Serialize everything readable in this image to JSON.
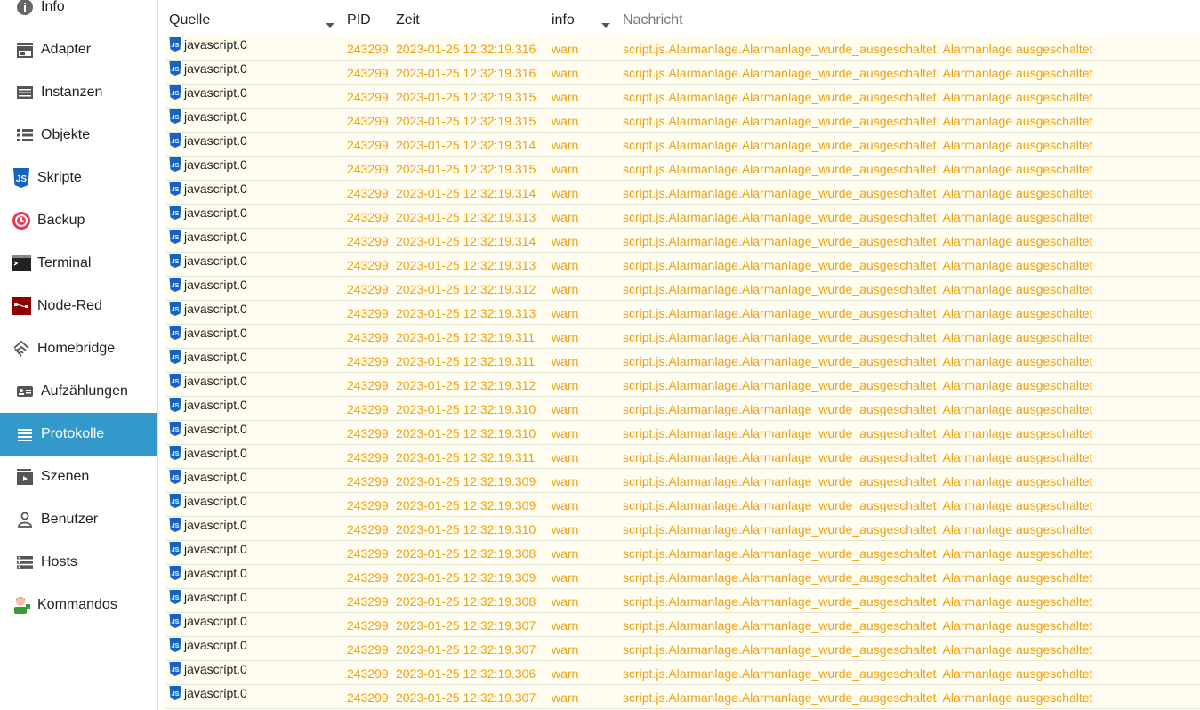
{
  "sidebar": {
    "items": [
      {
        "label": "Info",
        "icon": "info-icon"
      },
      {
        "label": "Adapter",
        "icon": "store-icon"
      },
      {
        "label": "Instanzen",
        "icon": "instances-icon"
      },
      {
        "label": "Objekte",
        "icon": "list-icon"
      },
      {
        "label": "Skripte",
        "icon": "javascript-icon"
      },
      {
        "label": "Backup",
        "icon": "backup-icon"
      },
      {
        "label": "Terminal",
        "icon": "terminal-icon"
      },
      {
        "label": "Node-Red",
        "icon": "node-red-icon"
      },
      {
        "label": "Homebridge",
        "icon": "homebridge-icon"
      },
      {
        "label": "Aufzählungen",
        "icon": "enum-icon"
      },
      {
        "label": "Protokolle",
        "icon": "log-icon",
        "active": true
      },
      {
        "label": "Szenen",
        "icon": "scenes-icon"
      },
      {
        "label": "Benutzer",
        "icon": "user-icon"
      },
      {
        "label": "Hosts",
        "icon": "hosts-icon"
      },
      {
        "label": "Kommandos",
        "icon": "commands-icon"
      }
    ]
  },
  "header": {
    "source_label": "Quelle",
    "pid_label": "PID",
    "time_label": "Zeit",
    "severity_value": "info",
    "message_placeholder": "Nachricht"
  },
  "colors": {
    "accent": "#3399cc",
    "warn": "#f0a010",
    "row_bg": "#fffdf0"
  },
  "log": {
    "rows": [
      {
        "source": "javascript.0",
        "pid": "243299",
        "time": "2023-01-25 12:32:19.316",
        "severity": "warn",
        "message": "script.js.Alarmanlage.Alarmanlage_wurde_ausgeschaltet: Alarmanlage ausgeschaltet"
      },
      {
        "source": "javascript.0",
        "pid": "243299",
        "time": "2023-01-25 12:32:19.316",
        "severity": "warn",
        "message": "script.js.Alarmanlage.Alarmanlage_wurde_ausgeschaltet: Alarmanlage ausgeschaltet"
      },
      {
        "source": "javascript.0",
        "pid": "243299",
        "time": "2023-01-25 12:32:19.315",
        "severity": "warn",
        "message": "script.js.Alarmanlage.Alarmanlage_wurde_ausgeschaltet: Alarmanlage ausgeschaltet"
      },
      {
        "source": "javascript.0",
        "pid": "243299",
        "time": "2023-01-25 12:32:19.315",
        "severity": "warn",
        "message": "script.js.Alarmanlage.Alarmanlage_wurde_ausgeschaltet: Alarmanlage ausgeschaltet"
      },
      {
        "source": "javascript.0",
        "pid": "243299",
        "time": "2023-01-25 12:32:19.314",
        "severity": "warn",
        "message": "script.js.Alarmanlage.Alarmanlage_wurde_ausgeschaltet: Alarmanlage ausgeschaltet"
      },
      {
        "source": "javascript.0",
        "pid": "243299",
        "time": "2023-01-25 12:32:19.315",
        "severity": "warn",
        "message": "script.js.Alarmanlage.Alarmanlage_wurde_ausgeschaltet: Alarmanlage ausgeschaltet"
      },
      {
        "source": "javascript.0",
        "pid": "243299",
        "time": "2023-01-25 12:32:19.314",
        "severity": "warn",
        "message": "script.js.Alarmanlage.Alarmanlage_wurde_ausgeschaltet: Alarmanlage ausgeschaltet"
      },
      {
        "source": "javascript.0",
        "pid": "243299",
        "time": "2023-01-25 12:32:19.313",
        "severity": "warn",
        "message": "script.js.Alarmanlage.Alarmanlage_wurde_ausgeschaltet: Alarmanlage ausgeschaltet"
      },
      {
        "source": "javascript.0",
        "pid": "243299",
        "time": "2023-01-25 12:32:19.314",
        "severity": "warn",
        "message": "script.js.Alarmanlage.Alarmanlage_wurde_ausgeschaltet: Alarmanlage ausgeschaltet"
      },
      {
        "source": "javascript.0",
        "pid": "243299",
        "time": "2023-01-25 12:32:19.313",
        "severity": "warn",
        "message": "script.js.Alarmanlage.Alarmanlage_wurde_ausgeschaltet: Alarmanlage ausgeschaltet"
      },
      {
        "source": "javascript.0",
        "pid": "243299",
        "time": "2023-01-25 12:32:19.312",
        "severity": "warn",
        "message": "script.js.Alarmanlage.Alarmanlage_wurde_ausgeschaltet: Alarmanlage ausgeschaltet"
      },
      {
        "source": "javascript.0",
        "pid": "243299",
        "time": "2023-01-25 12:32:19.313",
        "severity": "warn",
        "message": "script.js.Alarmanlage.Alarmanlage_wurde_ausgeschaltet: Alarmanlage ausgeschaltet"
      },
      {
        "source": "javascript.0",
        "pid": "243299",
        "time": "2023-01-25 12:32:19.311",
        "severity": "warn",
        "message": "script.js.Alarmanlage.Alarmanlage_wurde_ausgeschaltet: Alarmanlage ausgeschaltet"
      },
      {
        "source": "javascript.0",
        "pid": "243299",
        "time": "2023-01-25 12:32:19.311",
        "severity": "warn",
        "message": "script.js.Alarmanlage.Alarmanlage_wurde_ausgeschaltet: Alarmanlage ausgeschaltet"
      },
      {
        "source": "javascript.0",
        "pid": "243299",
        "time": "2023-01-25 12:32:19.312",
        "severity": "warn",
        "message": "script.js.Alarmanlage.Alarmanlage_wurde_ausgeschaltet: Alarmanlage ausgeschaltet"
      },
      {
        "source": "javascript.0",
        "pid": "243299",
        "time": "2023-01-25 12:32:19.310",
        "severity": "warn",
        "message": "script.js.Alarmanlage.Alarmanlage_wurde_ausgeschaltet: Alarmanlage ausgeschaltet"
      },
      {
        "source": "javascript.0",
        "pid": "243299",
        "time": "2023-01-25 12:32:19.310",
        "severity": "warn",
        "message": "script.js.Alarmanlage.Alarmanlage_wurde_ausgeschaltet: Alarmanlage ausgeschaltet"
      },
      {
        "source": "javascript.0",
        "pid": "243299",
        "time": "2023-01-25 12:32:19.311",
        "severity": "warn",
        "message": "script.js.Alarmanlage.Alarmanlage_wurde_ausgeschaltet: Alarmanlage ausgeschaltet"
      },
      {
        "source": "javascript.0",
        "pid": "243299",
        "time": "2023-01-25 12:32:19.309",
        "severity": "warn",
        "message": "script.js.Alarmanlage.Alarmanlage_wurde_ausgeschaltet: Alarmanlage ausgeschaltet"
      },
      {
        "source": "javascript.0",
        "pid": "243299",
        "time": "2023-01-25 12:32:19.309",
        "severity": "warn",
        "message": "script.js.Alarmanlage.Alarmanlage_wurde_ausgeschaltet: Alarmanlage ausgeschaltet"
      },
      {
        "source": "javascript.0",
        "pid": "243299",
        "time": "2023-01-25 12:32:19.310",
        "severity": "warn",
        "message": "script.js.Alarmanlage.Alarmanlage_wurde_ausgeschaltet: Alarmanlage ausgeschaltet"
      },
      {
        "source": "javascript.0",
        "pid": "243299",
        "time": "2023-01-25 12:32:19.308",
        "severity": "warn",
        "message": "script.js.Alarmanlage.Alarmanlage_wurde_ausgeschaltet: Alarmanlage ausgeschaltet"
      },
      {
        "source": "javascript.0",
        "pid": "243299",
        "time": "2023-01-25 12:32:19.309",
        "severity": "warn",
        "message": "script.js.Alarmanlage.Alarmanlage_wurde_ausgeschaltet: Alarmanlage ausgeschaltet"
      },
      {
        "source": "javascript.0",
        "pid": "243299",
        "time": "2023-01-25 12:32:19.308",
        "severity": "warn",
        "message": "script.js.Alarmanlage.Alarmanlage_wurde_ausgeschaltet: Alarmanlage ausgeschaltet"
      },
      {
        "source": "javascript.0",
        "pid": "243299",
        "time": "2023-01-25 12:32:19.307",
        "severity": "warn",
        "message": "script.js.Alarmanlage.Alarmanlage_wurde_ausgeschaltet: Alarmanlage ausgeschaltet"
      },
      {
        "source": "javascript.0",
        "pid": "243299",
        "time": "2023-01-25 12:32:19.307",
        "severity": "warn",
        "message": "script.js.Alarmanlage.Alarmanlage_wurde_ausgeschaltet: Alarmanlage ausgeschaltet"
      },
      {
        "source": "javascript.0",
        "pid": "243299",
        "time": "2023-01-25 12:32:19.306",
        "severity": "warn",
        "message": "script.js.Alarmanlage.Alarmanlage_wurde_ausgeschaltet: Alarmanlage ausgeschaltet"
      },
      {
        "source": "javascript.0",
        "pid": "243299",
        "time": "2023-01-25 12:32:19.307",
        "severity": "warn",
        "message": "script.js.Alarmanlage.Alarmanlage_wurde_ausgeschaltet: Alarmanlage ausgeschaltet"
      }
    ]
  }
}
